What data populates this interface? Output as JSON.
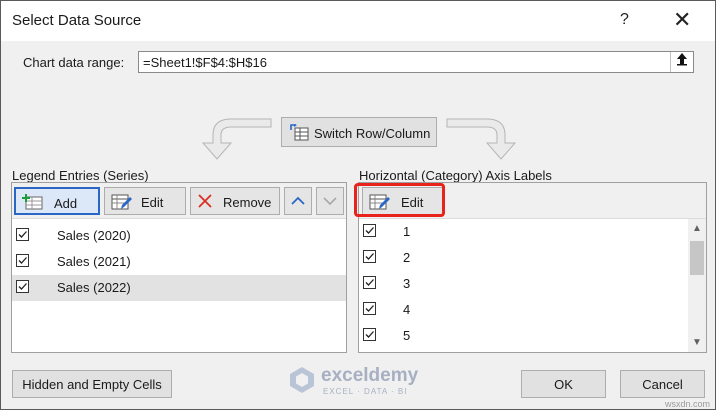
{
  "dialog": {
    "title": "Select Data Source",
    "help_label": "?",
    "close_label": "✕"
  },
  "chart_range": {
    "label": "Chart data range:",
    "value": "=Sheet1!$F$4:$H$16"
  },
  "switch_button": "Switch Row/Column",
  "legend": {
    "section_label": "Legend Entries (Series)",
    "add_label": "Add",
    "edit_label": "Edit",
    "remove_label": "Remove",
    "series": [
      {
        "label": "Sales (2020)",
        "checked": true
      },
      {
        "label": "Sales (2021)",
        "checked": true
      },
      {
        "label": "Sales (2022)",
        "checked": true
      }
    ]
  },
  "axis": {
    "section_label": "Horizontal (Category) Axis Labels",
    "edit_label": "Edit",
    "items": [
      {
        "label": "1",
        "checked": true
      },
      {
        "label": "2",
        "checked": true
      },
      {
        "label": "3",
        "checked": true
      },
      {
        "label": "4",
        "checked": true
      },
      {
        "label": "5",
        "checked": true
      }
    ]
  },
  "footer": {
    "hidden_cells_label": "Hidden and Empty Cells",
    "ok_label": "OK",
    "cancel_label": "Cancel"
  },
  "watermark": {
    "name": "exceldemy",
    "tagline": "EXCEL · DATA · BI",
    "site": "wsxdn.com"
  },
  "colors": {
    "highlight": "#e8231c",
    "selected_border": "#2a66c6",
    "arrow_icon": "#2a66c6",
    "remove_icon": "#d93025"
  }
}
